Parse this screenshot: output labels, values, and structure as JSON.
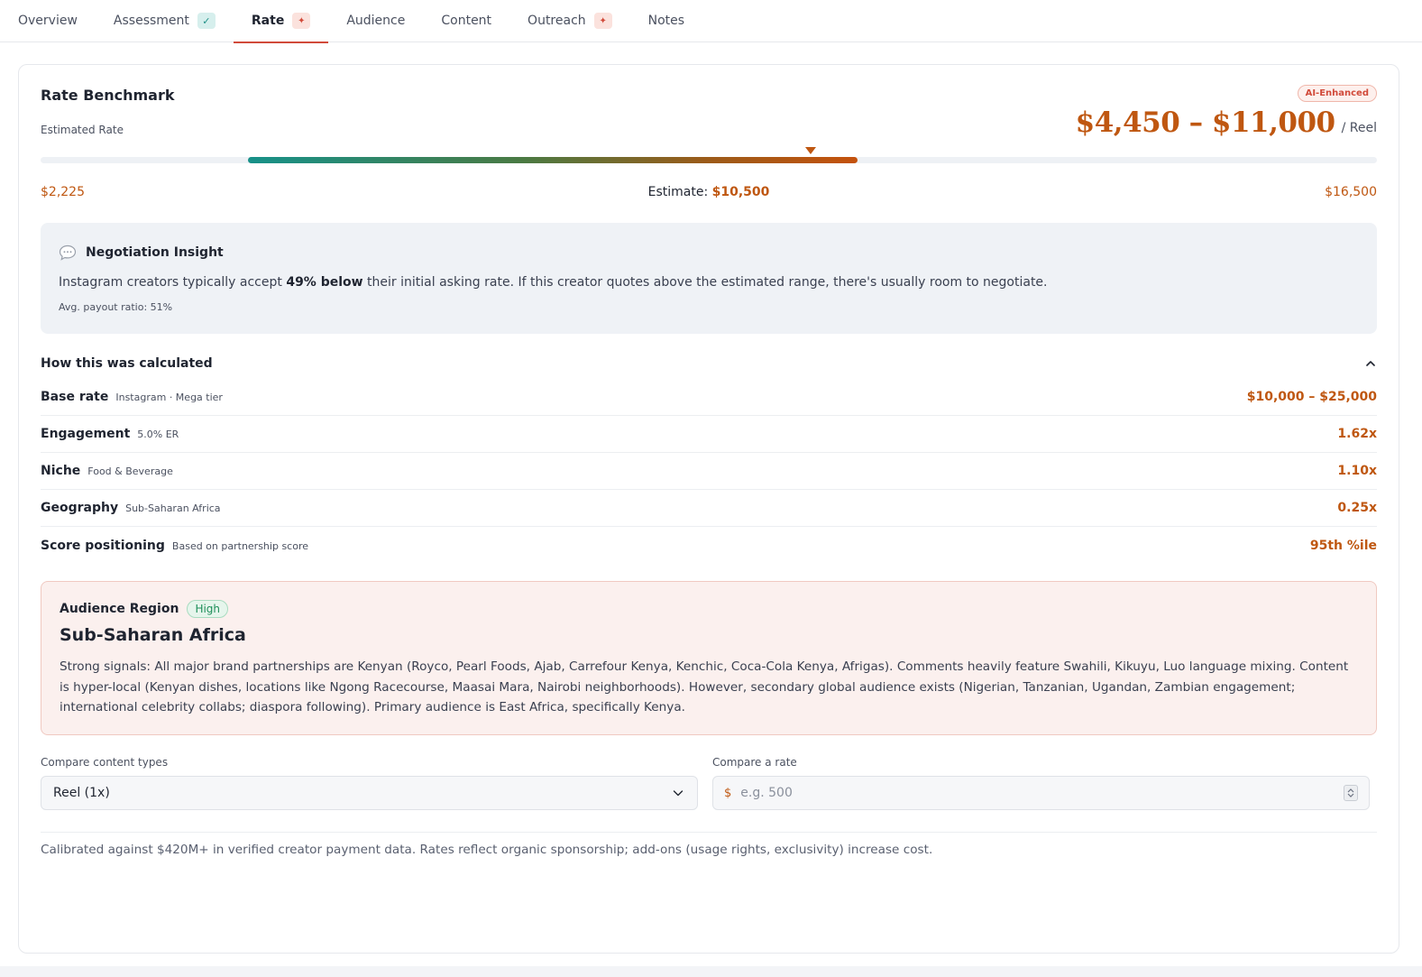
{
  "tabs": [
    {
      "label": "Overview",
      "badge": ""
    },
    {
      "label": "Assessment",
      "badge": "check"
    },
    {
      "label": "Rate",
      "badge": "spark"
    },
    {
      "label": "Audience",
      "badge": ""
    },
    {
      "label": "Content",
      "badge": ""
    },
    {
      "label": "Outreach",
      "badge": "spark"
    },
    {
      "label": "Notes",
      "badge": ""
    }
  ],
  "active_tab": "Rate",
  "badge_glyphs": {
    "check": "✓",
    "spark": "✦"
  },
  "benchmark": {
    "title": "Rate Benchmark",
    "ai_badge": "AI-Enhanced",
    "estimated_label": "Estimated Rate",
    "range_text": "$4,450 – $11,000",
    "unit": "/ Reel",
    "scale_min": "$2,225",
    "scale_max": "$16,500",
    "estimate_label": "Estimate:",
    "estimate_value": "$10,500",
    "scale_min_value": 2225,
    "scale_max_value": 16500,
    "range_low_value": 4450,
    "range_high_value": 11000,
    "estimate_number": 10500
  },
  "insight": {
    "icon": "chat-bubble-icon",
    "title": "Negotiation Insight",
    "text_before": "Instagram creators typically accept ",
    "text_bold": "49% below",
    "text_after": " their initial asking rate. If this creator quotes above the estimated range, there's usually room to negotiate.",
    "sub": "Avg. payout ratio: 51%"
  },
  "calc": {
    "title": "How this was calculated",
    "rows": [
      {
        "label": "Base rate",
        "sub": "Instagram · Mega tier",
        "value": "$10,000 – $25,000"
      },
      {
        "label": "Engagement",
        "sub": "5.0% ER",
        "value": "1.62x"
      },
      {
        "label": "Niche",
        "sub": "Food & Beverage",
        "value": "1.10x"
      },
      {
        "label": "Geography",
        "sub": "Sub-Saharan Africa",
        "value": "0.25x"
      },
      {
        "label": "Score positioning",
        "sub": "Based on partnership score",
        "value": "95th %ile"
      }
    ]
  },
  "region": {
    "label": "Audience Region",
    "confidence": "High",
    "title": "Sub-Saharan Africa",
    "text": "Strong signals: All major brand partnerships are Kenyan (Royco, Pearl Foods, Ajab, Carrefour Kenya, Kenchic, Coca-Cola Kenya, Afrigas). Comments heavily feature Swahili, Kikuyu, Luo language mixing. Content is hyper-local (Kenyan dishes, locations like Ngong Racecourse, Maasai Mara, Nairobi neighborhoods). However, secondary global audience exists (Nigerian, Tanzanian, Ugandan, Zambian engagement; international celebrity collabs; diaspora following). Primary audience is East Africa, specifically Kenya."
  },
  "compare": {
    "types_label": "Compare content types",
    "types_value": "Reel (1x)",
    "rate_label": "Compare a rate",
    "currency": "$",
    "rate_placeholder": "e.g. 500",
    "rate_value": ""
  },
  "footer": "Calibrated against $420M+ in verified creator payment data. Rates reflect organic sponsorship; add-ons (usage rights, exclusivity) increase cost.",
  "colors": {
    "accent": "#bf5711",
    "brand_red": "#d14a3a",
    "teal": "#179189"
  }
}
